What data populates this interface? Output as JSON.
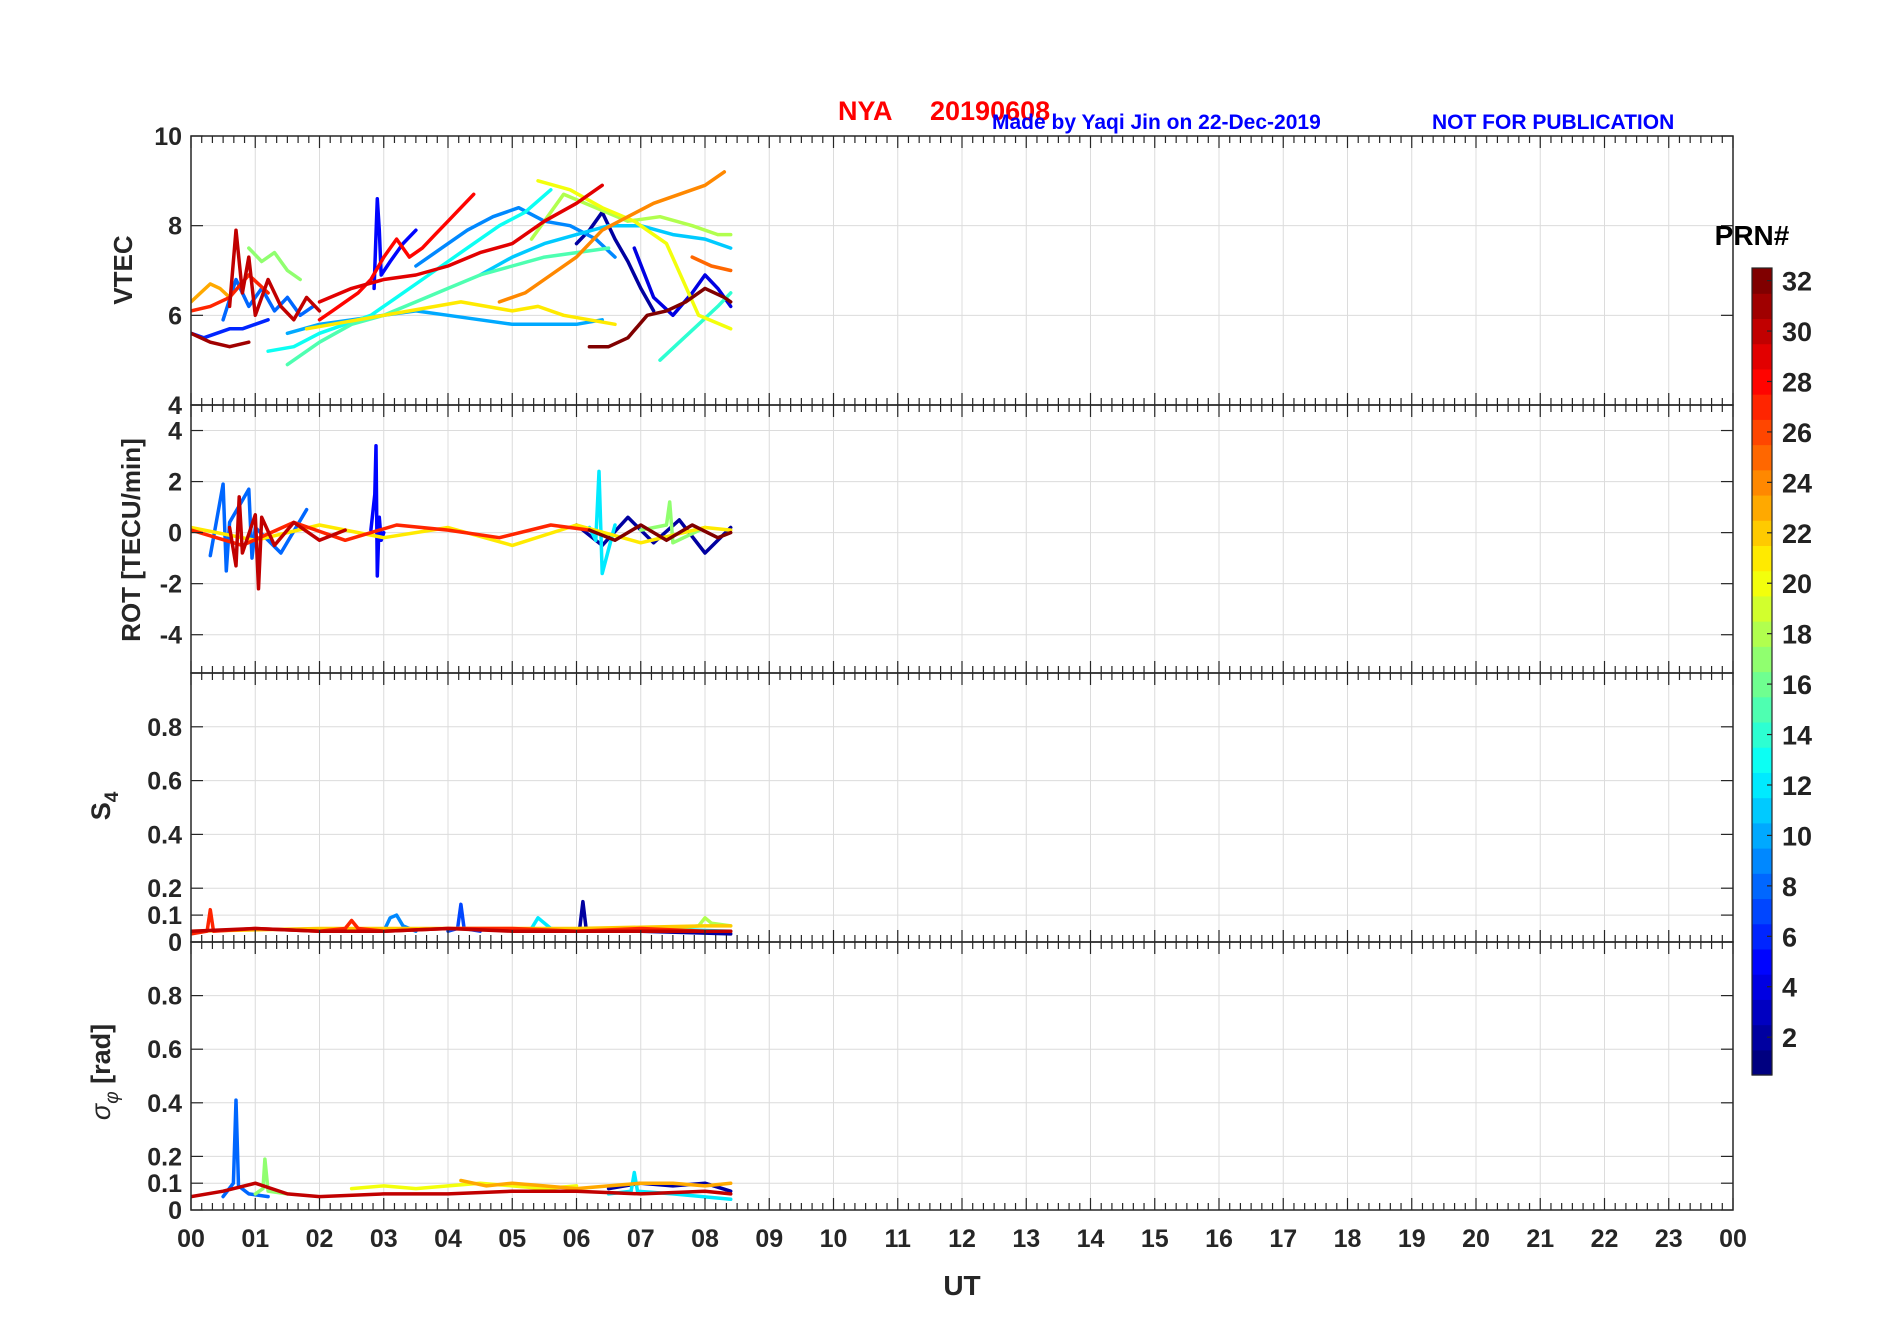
{
  "header": {
    "station": "NYA",
    "date": "20190608",
    "credit": "Made by Yaqi Jin on 22-Dec-2019",
    "notice": "NOT FOR PUBLICATION"
  },
  "colors": {
    "station_text": "#ff0000",
    "credit_text": "#0000ff",
    "grid": "#dcdcdc",
    "axis": "#262626"
  },
  "chart_data": [
    {
      "type": "line",
      "ylabel": "VTEC",
      "xlim": [
        0,
        24
      ],
      "ylim": [
        4,
        10
      ],
      "yticks": [
        4,
        6,
        8,
        10
      ],
      "grid": true,
      "series": [
        {
          "prn": 2,
          "x": [
            6.0,
            6.2,
            6.4,
            6.6,
            6.8,
            7.0,
            7.2
          ],
          "y": [
            7.6,
            7.9,
            8.3,
            7.7,
            7.2,
            6.6,
            6.1
          ]
        },
        {
          "prn": 4,
          "x": [
            6.9,
            7.2,
            7.5,
            7.8,
            8.0,
            8.2,
            8.4
          ],
          "y": [
            7.5,
            6.4,
            6.0,
            6.5,
            6.9,
            6.6,
            6.2
          ]
        },
        {
          "prn": 5,
          "x": [
            2.85,
            2.88,
            2.9,
            2.93,
            2.96,
            3.1,
            3.3,
            3.5
          ],
          "y": [
            6.6,
            7.8,
            8.6,
            7.9,
            6.9,
            7.2,
            7.6,
            7.9
          ]
        },
        {
          "prn": 6,
          "x": [
            0.0,
            0.2,
            0.4,
            0.6,
            0.8,
            1.0,
            1.2
          ],
          "y": [
            5.6,
            5.5,
            5.6,
            5.7,
            5.7,
            5.8,
            5.9
          ]
        },
        {
          "prn": 8,
          "x": [
            0.5,
            0.7,
            0.9,
            1.1,
            1.3,
            1.5,
            1.7,
            1.9
          ],
          "y": [
            5.9,
            6.8,
            6.2,
            6.6,
            6.1,
            6.4,
            6.0,
            6.2
          ]
        },
        {
          "prn": 9,
          "x": [
            3.5,
            3.9,
            4.3,
            4.7,
            5.1,
            5.5,
            5.9,
            6.3,
            6.6
          ],
          "y": [
            7.1,
            7.5,
            7.9,
            8.2,
            8.4,
            8.1,
            8.0,
            7.7,
            7.3
          ]
        },
        {
          "prn": 10,
          "x": [
            1.5,
            2.0,
            2.5,
            3.0,
            3.5,
            4.0,
            4.5,
            5.0,
            5.5,
            6.0,
            6.4
          ],
          "y": [
            5.6,
            5.8,
            5.9,
            6.0,
            6.1,
            6.0,
            5.9,
            5.8,
            5.8,
            5.8,
            5.9
          ]
        },
        {
          "prn": 11,
          "x": [
            4.5,
            5.0,
            5.5,
            6.0,
            6.5,
            7.0,
            7.5,
            8.0,
            8.4
          ],
          "y": [
            6.9,
            7.3,
            7.6,
            7.8,
            8.0,
            8.0,
            7.8,
            7.7,
            7.5
          ]
        },
        {
          "prn": 13,
          "x": [
            1.2,
            1.6,
            2.0,
            2.4,
            2.8,
            3.2,
            3.6,
            4.0,
            4.4,
            4.8,
            5.2,
            5.6
          ],
          "y": [
            5.2,
            5.3,
            5.6,
            5.8,
            6.0,
            6.4,
            6.8,
            7.2,
            7.6,
            8.0,
            8.3,
            8.8
          ]
        },
        {
          "prn": 14,
          "x": [
            7.3,
            7.6,
            7.9,
            8.2,
            8.4
          ],
          "y": [
            5.0,
            5.4,
            5.8,
            6.2,
            6.5
          ]
        },
        {
          "prn": 15,
          "x": [
            1.5,
            2.0,
            2.5,
            3.0,
            3.5,
            4.0,
            4.5,
            5.0,
            5.5,
            6.0,
            6.5
          ],
          "y": [
            4.9,
            5.4,
            5.8,
            6.0,
            6.3,
            6.6,
            6.9,
            7.1,
            7.3,
            7.4,
            7.5
          ]
        },
        {
          "prn": 17,
          "x": [
            0.9,
            1.1,
            1.3,
            1.5,
            1.7
          ],
          "y": [
            7.5,
            7.2,
            7.4,
            7.0,
            6.8
          ]
        },
        {
          "prn": 18,
          "x": [
            5.3,
            5.8,
            6.3,
            6.8,
            7.3,
            7.8,
            8.2,
            8.4
          ],
          "y": [
            7.7,
            8.7,
            8.4,
            8.1,
            8.2,
            8.0,
            7.8,
            7.8
          ]
        },
        {
          "prn": 20,
          "x": [
            5.4,
            5.9,
            6.4,
            6.9,
            7.4,
            7.9,
            8.4
          ],
          "y": [
            9.0,
            8.8,
            8.4,
            8.1,
            7.6,
            6.0,
            5.7
          ]
        },
        {
          "prn": 21,
          "x": [
            1.8,
            2.2,
            2.6,
            3.0,
            3.4,
            3.8,
            4.2,
            4.6,
            5.0,
            5.4,
            5.8,
            6.2,
            6.6
          ],
          "y": [
            5.7,
            5.8,
            5.9,
            6.0,
            6.1,
            6.2,
            6.3,
            6.2,
            6.1,
            6.2,
            6.0,
            5.9,
            5.8
          ]
        },
        {
          "prn": 23,
          "x": [
            0.0,
            0.15,
            0.3,
            0.45,
            0.6
          ],
          "y": [
            6.3,
            6.5,
            6.7,
            6.6,
            6.4
          ]
        },
        {
          "prn": 24,
          "x": [
            4.8,
            5.2,
            5.6,
            6.0,
            6.4,
            6.8,
            7.2,
            7.6,
            8.0,
            8.3
          ],
          "y": [
            6.3,
            6.5,
            6.9,
            7.3,
            7.9,
            8.2,
            8.5,
            8.7,
            8.9,
            9.2
          ]
        },
        {
          "prn": 25,
          "x": [
            7.8,
            8.1,
            8.4
          ],
          "y": [
            7.3,
            7.1,
            7.0
          ]
        },
        {
          "prn": 27,
          "x": [
            0.0,
            0.3,
            0.6,
            0.9,
            1.2
          ],
          "y": [
            6.1,
            6.2,
            6.4,
            6.9,
            6.5
          ]
        },
        {
          "prn": 28,
          "x": [
            2.0,
            2.2,
            2.4,
            2.6,
            2.8,
            3.0,
            3.2,
            3.4,
            3.6,
            3.8,
            4.0,
            4.2,
            4.4
          ],
          "y": [
            5.9,
            6.1,
            6.3,
            6.5,
            6.8,
            7.3,
            7.7,
            7.3,
            7.5,
            7.8,
            8.1,
            8.4,
            8.7
          ]
        },
        {
          "prn": 29,
          "x": [
            2.0,
            2.5,
            3.0,
            3.5,
            4.0,
            4.5,
            5.0,
            5.5,
            6.0,
            6.4
          ],
          "y": [
            6.3,
            6.6,
            6.8,
            6.9,
            7.1,
            7.4,
            7.6,
            8.1,
            8.5,
            8.9
          ]
        },
        {
          "prn": 30,
          "x": [
            0.6,
            0.7,
            0.8,
            0.9,
            1.0,
            1.2,
            1.4,
            1.6,
            1.8,
            2.0
          ],
          "y": [
            6.2,
            7.9,
            6.5,
            7.3,
            6.0,
            6.8,
            6.2,
            5.9,
            6.4,
            6.1
          ]
        },
        {
          "prn": 31,
          "x": [
            0.0,
            0.3,
            0.6,
            0.9
          ],
          "y": [
            5.6,
            5.4,
            5.3,
            5.4
          ]
        },
        {
          "prn": 32,
          "x": [
            6.2,
            6.5,
            6.8,
            7.1,
            7.4,
            7.7,
            8.0,
            8.3,
            8.4
          ],
          "y": [
            5.3,
            5.3,
            5.5,
            6.0,
            6.1,
            6.3,
            6.6,
            6.4,
            6.3
          ]
        }
      ]
    },
    {
      "type": "line",
      "ylabel": "ROT [TECU/min]",
      "xlim": [
        0,
        24
      ],
      "ylim": [
        -5.5,
        5
      ],
      "yticks": [
        -4,
        -2,
        0,
        2,
        4
      ],
      "grid": true,
      "series": [
        {
          "prn": 2,
          "x": [
            6.0,
            6.4,
            6.8,
            7.2,
            7.6,
            8.0,
            8.4
          ],
          "y": [
            0.3,
            -0.5,
            0.6,
            -0.4,
            0.5,
            -0.8,
            0.2
          ]
        },
        {
          "prn": 5,
          "x": [
            2.8,
            2.86,
            2.88,
            2.9,
            2.93,
            2.96,
            3.0
          ],
          "y": [
            0.1,
            1.5,
            3.4,
            -1.7,
            0.6,
            -0.3,
            0.0
          ]
        },
        {
          "prn": 8,
          "x": [
            0.3,
            0.5,
            0.55,
            0.6,
            0.9,
            0.95,
            1.0,
            1.4,
            1.8
          ],
          "y": [
            -0.9,
            1.9,
            -1.5,
            0.4,
            1.7,
            -1.0,
            0.2,
            -0.8,
            0.9
          ]
        },
        {
          "prn": 12,
          "x": [
            6.2,
            6.3,
            6.35,
            6.4,
            6.6
          ],
          "y": [
            0.2,
            -0.3,
            2.4,
            -1.6,
            0.3
          ]
        },
        {
          "prn": 17,
          "x": [
            7.0,
            7.4,
            7.45,
            7.5,
            8.0
          ],
          "y": [
            0.1,
            0.3,
            1.2,
            -0.4,
            0.2
          ]
        },
        {
          "prn": 21,
          "x": [
            0.0,
            1.0,
            2.0,
            3.0,
            4.0,
            5.0,
            6.0,
            7.0,
            8.0,
            8.4
          ],
          "y": [
            0.2,
            -0.3,
            0.3,
            -0.2,
            0.2,
            -0.5,
            0.3,
            -0.4,
            0.2,
            0.1
          ]
        },
        {
          "prn": 27,
          "x": [
            0.0,
            0.8,
            1.6,
            2.4,
            3.2,
            4.0,
            4.8,
            5.6,
            6.2
          ],
          "y": [
            0.1,
            -0.5,
            0.4,
            -0.3,
            0.3,
            0.1,
            -0.2,
            0.3,
            0.1
          ]
        },
        {
          "prn": 30,
          "x": [
            0.6,
            0.7,
            0.75,
            0.8,
            1.0,
            1.05,
            1.1,
            1.3,
            1.6,
            2.0,
            2.4
          ],
          "y": [
            0.2,
            -1.3,
            1.4,
            -0.8,
            0.7,
            -2.2,
            0.6,
            -0.5,
            0.4,
            -0.3,
            0.1
          ]
        },
        {
          "prn": 32,
          "x": [
            6.2,
            6.6,
            7.0,
            7.4,
            7.8,
            8.2,
            8.4
          ],
          "y": [
            0.1,
            -0.3,
            0.3,
            -0.3,
            0.3,
            -0.2,
            0.0
          ]
        }
      ]
    },
    {
      "type": "line",
      "ylabel": "S4",
      "xlim": [
        0,
        24
      ],
      "ylim": [
        0,
        1
      ],
      "yticks": [
        0,
        0.1,
        0.2,
        0.4,
        0.6,
        0.8
      ],
      "grid": true,
      "series": [
        {
          "prn": 2,
          "x": [
            5.9,
            6.05,
            6.1,
            6.15,
            6.3,
            7.0,
            8.4
          ],
          "y": [
            0.04,
            0.05,
            0.15,
            0.05,
            0.04,
            0.04,
            0.03
          ]
        },
        {
          "prn": 7,
          "x": [
            4.0,
            4.15,
            4.2,
            4.25,
            4.5
          ],
          "y": [
            0.04,
            0.05,
            0.14,
            0.05,
            0.04
          ]
        },
        {
          "prn": 9,
          "x": [
            3.0,
            3.1,
            3.2,
            3.3,
            3.5
          ],
          "y": [
            0.04,
            0.09,
            0.1,
            0.06,
            0.04
          ]
        },
        {
          "prn": 12,
          "x": [
            5.0,
            5.3,
            5.4,
            5.6,
            6.0,
            7.0,
            8.4
          ],
          "y": [
            0.04,
            0.05,
            0.09,
            0.05,
            0.04,
            0.05,
            0.04
          ]
        },
        {
          "prn": 18,
          "x": [
            7.5,
            7.9,
            8.0,
            8.1,
            8.4
          ],
          "y": [
            0.05,
            0.06,
            0.09,
            0.07,
            0.06
          ]
        },
        {
          "prn": 22,
          "x": [
            0.0,
            2.0,
            4.0,
            6.0,
            8.0,
            8.4
          ],
          "y": [
            0.04,
            0.05,
            0.05,
            0.05,
            0.06,
            0.06
          ]
        },
        {
          "prn": 27,
          "x": [
            0.0,
            0.25,
            0.3,
            0.35,
            1.0,
            2.0,
            2.4,
            2.5,
            2.6,
            3.0,
            4.0,
            5.0,
            6.0,
            7.0,
            8.0,
            8.4
          ],
          "y": [
            0.03,
            0.04,
            0.12,
            0.04,
            0.05,
            0.04,
            0.05,
            0.08,
            0.05,
            0.04,
            0.05,
            0.05,
            0.04,
            0.05,
            0.04,
            0.04
          ]
        },
        {
          "prn": 30,
          "x": [
            0.0,
            1.0,
            2.0,
            3.0,
            4.0,
            5.0,
            6.0,
            7.0,
            8.0,
            8.4
          ],
          "y": [
            0.04,
            0.05,
            0.04,
            0.04,
            0.05,
            0.04,
            0.04,
            0.04,
            0.04,
            0.04
          ]
        }
      ]
    },
    {
      "type": "line",
      "ylabel": "σφ [rad]",
      "xlim": [
        0,
        24
      ],
      "ylim": [
        0,
        1
      ],
      "yticks": [
        0,
        0.1,
        0.2,
        0.4,
        0.6,
        0.8
      ],
      "grid": true,
      "series": [
        {
          "prn": 2,
          "x": [
            6.5,
            7.0,
            7.5,
            8.0,
            8.4
          ],
          "y": [
            0.08,
            0.1,
            0.09,
            0.1,
            0.07
          ]
        },
        {
          "prn": 8,
          "x": [
            0.5,
            0.66,
            0.7,
            0.74,
            0.9,
            1.2
          ],
          "y": [
            0.05,
            0.1,
            0.41,
            0.09,
            0.06,
            0.05
          ]
        },
        {
          "prn": 12,
          "x": [
            6.5,
            6.85,
            6.9,
            6.95,
            7.5,
            8.4
          ],
          "y": [
            0.06,
            0.07,
            0.14,
            0.07,
            0.06,
            0.04
          ]
        },
        {
          "prn": 17,
          "x": [
            1.0,
            1.12,
            1.15,
            1.2,
            1.5
          ],
          "y": [
            0.06,
            0.08,
            0.19,
            0.07,
            0.06
          ]
        },
        {
          "prn": 20,
          "x": [
            2.5,
            3.0,
            3.5,
            4.0,
            4.5,
            5.0,
            5.5,
            6.0
          ],
          "y": [
            0.08,
            0.09,
            0.08,
            0.09,
            0.1,
            0.09,
            0.08,
            0.09
          ]
        },
        {
          "prn": 23,
          "x": [
            4.2,
            4.6,
            5.0,
            5.5,
            6.0,
            6.5,
            7.0,
            7.5,
            8.0,
            8.4
          ],
          "y": [
            0.11,
            0.09,
            0.1,
            0.09,
            0.08,
            0.09,
            0.1,
            0.1,
            0.09,
            0.1
          ]
        },
        {
          "prn": 30,
          "x": [
            0.0,
            0.5,
            1.0,
            1.5,
            2.0,
            3.0,
            4.0,
            5.0,
            6.0,
            7.0,
            8.0,
            8.4
          ],
          "y": [
            0.05,
            0.07,
            0.1,
            0.06,
            0.05,
            0.06,
            0.06,
            0.07,
            0.07,
            0.06,
            0.07,
            0.06
          ]
        }
      ]
    }
  ],
  "x_axis": {
    "label": "UT",
    "tick_labels": [
      "00",
      "01",
      "02",
      "03",
      "04",
      "05",
      "06",
      "07",
      "08",
      "09",
      "10",
      "11",
      "12",
      "13",
      "14",
      "15",
      "16",
      "17",
      "18",
      "19",
      "20",
      "21",
      "22",
      "23",
      "00"
    ]
  },
  "colorbar": {
    "title": "PRN#",
    "min": 1,
    "max": 32,
    "colormap": "jet",
    "tick_labels": [
      "2",
      "4",
      "6",
      "8",
      "10",
      "12",
      "14",
      "16",
      "18",
      "20",
      "22",
      "24",
      "26",
      "28",
      "30",
      "32"
    ]
  }
}
